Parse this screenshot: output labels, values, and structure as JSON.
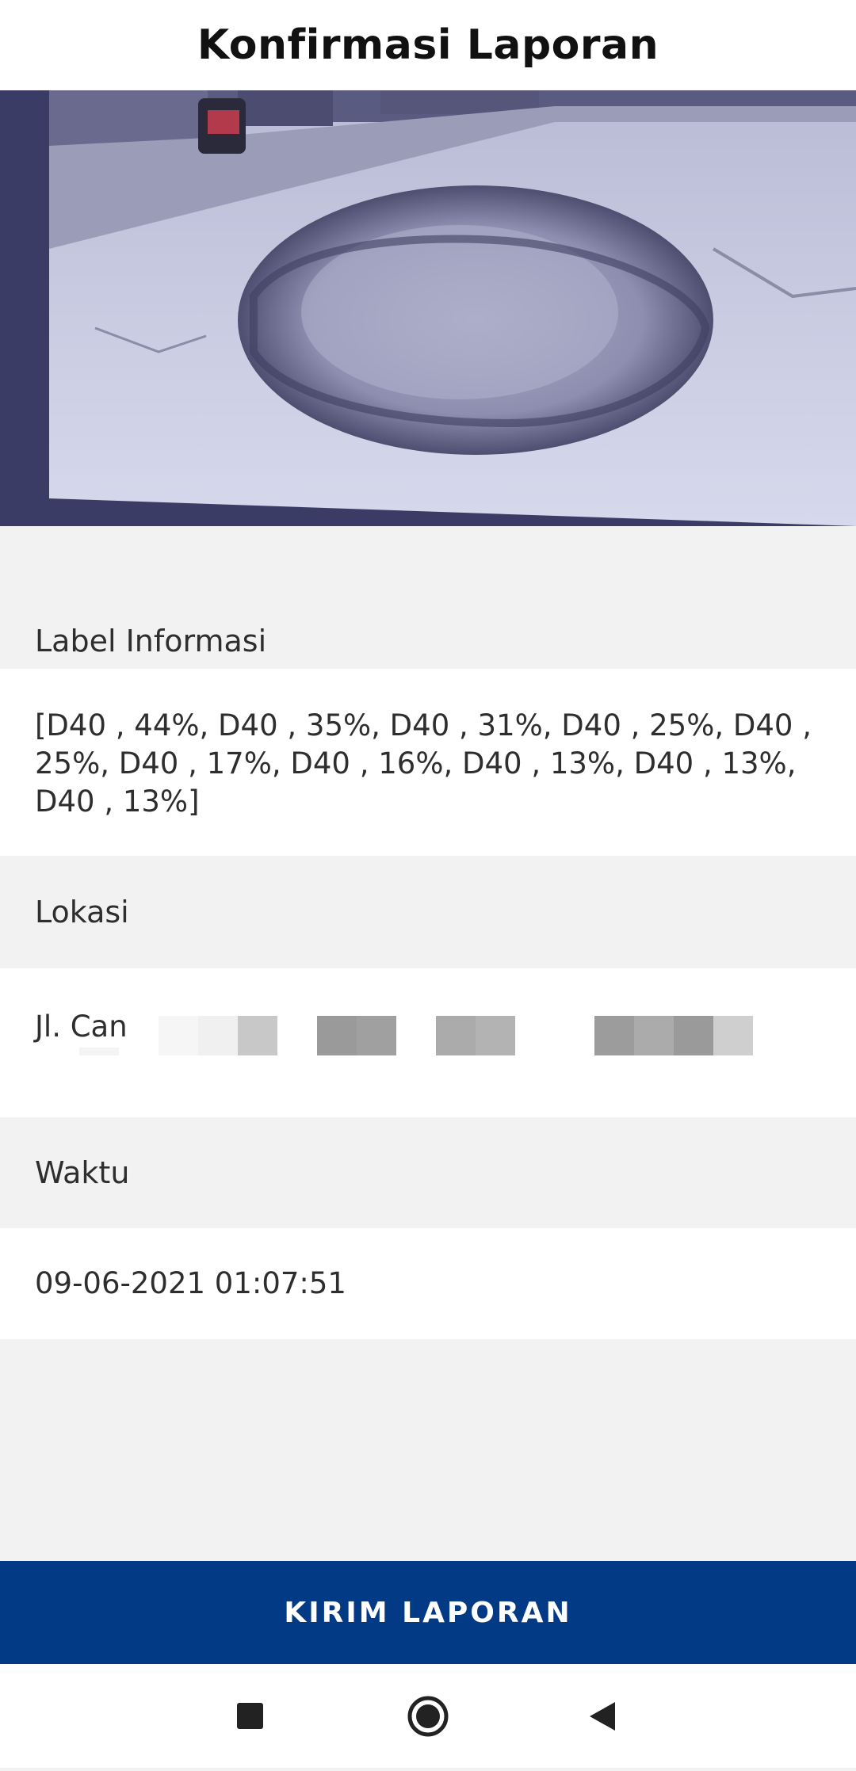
{
  "header": {
    "title": "Konfirmasi Laporan"
  },
  "photo": {
    "description_icon": "pothole-road-photo"
  },
  "sections": {
    "label_header": "Label Informasi",
    "label_value": "[D40 , 44%, D40 , 35%, D40 , 31%, D40 , 25%, D40 , 25%, D40 , 17%, D40 , 16%, D40 , 13%, D40 , 13%, D40 , 13%]",
    "location_header": "Lokasi",
    "location_value": "Jl. Can",
    "time_header": "Waktu",
    "time_value": "09-06-2021 01:07:51"
  },
  "action": {
    "submit_label": "KIRIM LAPORAN"
  },
  "nav": {
    "recents_icon": "square-icon",
    "home_icon": "circle-icon",
    "back_icon": "triangle-back-icon"
  },
  "colors": {
    "primary": "#033a85",
    "background": "#f2f2f2",
    "surface": "#ffffff"
  }
}
